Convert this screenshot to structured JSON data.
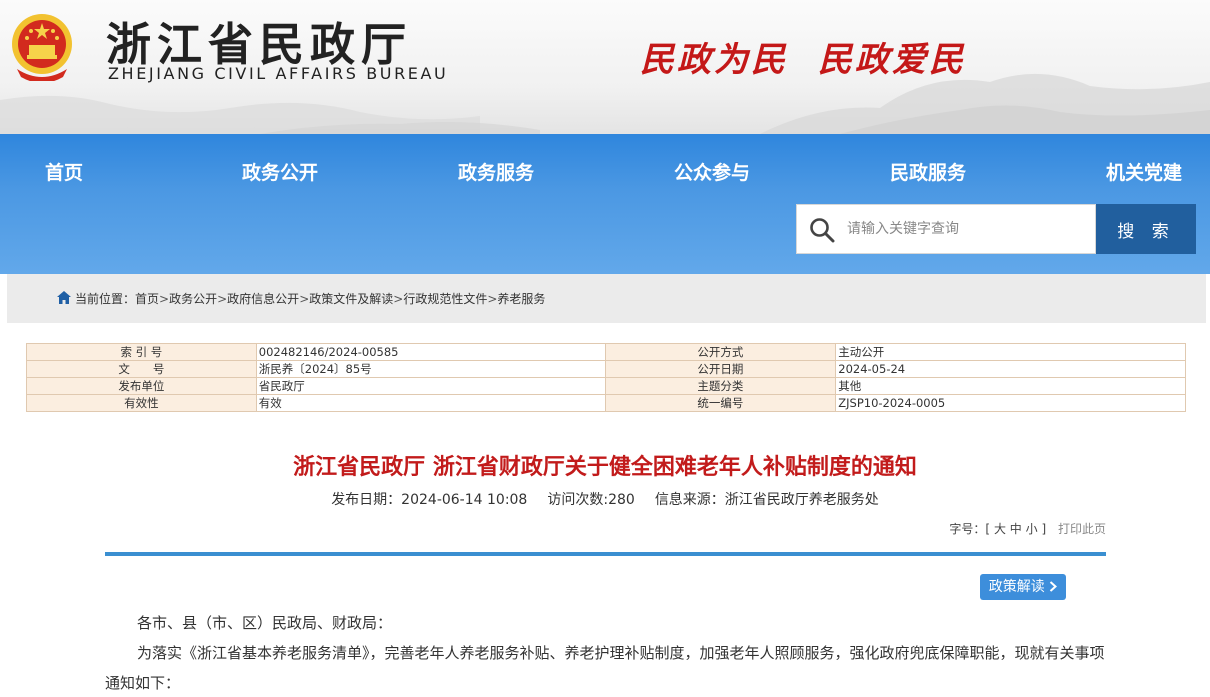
{
  "header": {
    "title": "浙江省民政厅",
    "subtitle": "ZHEJIANG CIVIL AFFAIRS BUREAU",
    "slogan_left": "民政为民",
    "slogan_right": "民政爱民",
    "slogan_color": "#c41818"
  },
  "nav": {
    "items": [
      "首页",
      "政务公开",
      "政务服务",
      "公众参与",
      "民政服务",
      "机关党建"
    ],
    "bar_color": "#3a8fe0",
    "search_placeholder": "请输入关键字查询",
    "search_button": "搜 索",
    "search_button_color": "#215f9e"
  },
  "breadcrumb": {
    "label": "当前位置：",
    "items": [
      "首页",
      "政务公开",
      "政府信息公开",
      "政策文件及解读",
      "行政规范性文件",
      "养老服务"
    ],
    "separator": ">"
  },
  "meta": {
    "rows": [
      [
        "索 引 号",
        "002482146/2024-00585",
        "公开方式",
        "主动公开"
      ],
      [
        "文　　号",
        "浙民养〔2024〕85号",
        "公开日期",
        "2024-05-24"
      ],
      [
        "发布单位",
        "省民政厅",
        "主题分类",
        "其他"
      ],
      [
        "有效性",
        "有效",
        "统一编号",
        "ZJSP10-2024-0005"
      ]
    ]
  },
  "article": {
    "title": "浙江省民政厅 浙江省财政厅关于健全困难老年人补贴制度的通知",
    "title_color": "#c21b1b",
    "publish_date": "发布日期：2024-06-14 10:08",
    "visits": "访问次数:280",
    "source": "信息来源：浙江省民政厅养老服务处",
    "font_label": "字号：[",
    "font_large": "大",
    "font_medium": "中",
    "font_small": "小",
    "font_close": "]",
    "print": "打印此页",
    "policy_button": "政策解读",
    "salutation": "各市、县（市、区）民政局、财政局：",
    "paragraph": "为落实《浙江省基本养老服务清单》，完善老年人养老服务补贴、养老护理补贴制度，加强老年人照顾服务，强化政府兜底保障职能，现就有关事项通知如下："
  }
}
